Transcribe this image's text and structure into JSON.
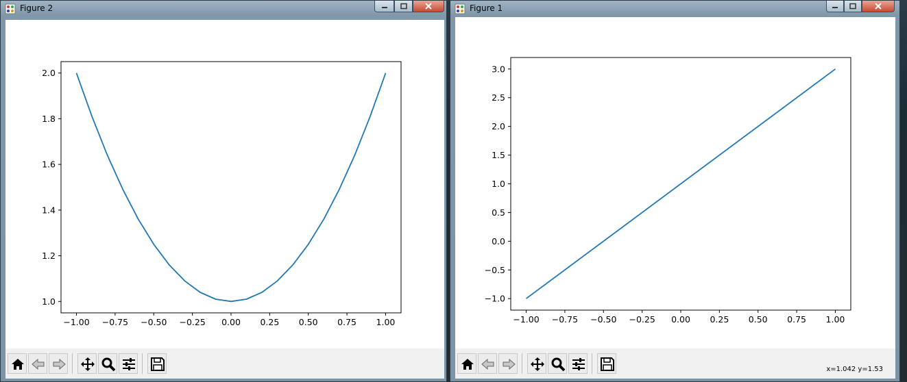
{
  "windows": [
    {
      "title": "Figure 2",
      "coords_text": "",
      "chart_data": {
        "type": "line",
        "title": "",
        "xlabel": "",
        "ylabel": "",
        "x": [
          -1.0,
          -0.9,
          -0.8,
          -0.7,
          -0.6,
          -0.5,
          -0.4,
          -0.3,
          -0.2,
          -0.1,
          0.0,
          0.1,
          0.2,
          0.3,
          0.4,
          0.5,
          0.6,
          0.7,
          0.8,
          0.9,
          1.0
        ],
        "y": [
          2.0,
          1.81,
          1.64,
          1.49,
          1.36,
          1.25,
          1.16,
          1.09,
          1.04,
          1.01,
          1.0,
          1.01,
          1.04,
          1.09,
          1.16,
          1.25,
          1.36,
          1.49,
          1.64,
          1.81,
          2.0
        ],
        "xlim": [
          -1.1,
          1.1
        ],
        "ylim": [
          0.95,
          2.05
        ],
        "xticks": [
          -1.0,
          -0.75,
          -0.5,
          -0.25,
          0.0,
          0.25,
          0.5,
          0.75,
          1.0
        ],
        "xtick_labels": [
          "−1.00",
          "−0.75",
          "−0.50",
          "−0.25",
          "0.00",
          "0.25",
          "0.50",
          "0.75",
          "1.00"
        ],
        "yticks": [
          1.0,
          1.2,
          1.4,
          1.6,
          1.8,
          2.0
        ],
        "ytick_labels": [
          "1.0",
          "1.2",
          "1.4",
          "1.6",
          "1.8",
          "2.0"
        ],
        "grid": false,
        "line_color": "#1f77b4"
      }
    },
    {
      "title": "Figure 1",
      "coords_text": "x=1.042 y=1.53",
      "chart_data": {
        "type": "line",
        "title": "",
        "xlabel": "",
        "ylabel": "",
        "x": [
          -1.0,
          1.0
        ],
        "y": [
          -1.0,
          3.0
        ],
        "xlim": [
          -1.1,
          1.1
        ],
        "ylim": [
          -1.2,
          3.2
        ],
        "xticks": [
          -1.0,
          -0.75,
          -0.5,
          -0.25,
          0.0,
          0.25,
          0.5,
          0.75,
          1.0
        ],
        "xtick_labels": [
          "−1.00",
          "−0.75",
          "−0.50",
          "−0.25",
          "0.00",
          "0.25",
          "0.50",
          "0.75",
          "1.00"
        ],
        "yticks": [
          -1.0,
          -0.5,
          0.0,
          0.5,
          1.0,
          1.5,
          2.0,
          2.5,
          3.0
        ],
        "ytick_labels": [
          "−1.0",
          "−0.5",
          "0.0",
          "0.5",
          "1.0",
          "1.5",
          "2.0",
          "2.5",
          "3.0"
        ],
        "grid": false,
        "line_color": "#1f77b4"
      }
    }
  ],
  "toolbar_icons": [
    "home-icon",
    "back-icon",
    "forward-icon",
    "pan-icon",
    "zoom-icon",
    "configure-subplots-icon",
    "save-icon"
  ]
}
